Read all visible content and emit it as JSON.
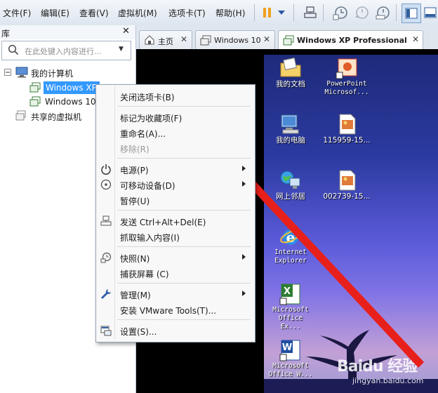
{
  "menubar": {
    "items": [
      "文件(F)",
      "编辑(E)",
      "查看(V)",
      "虚拟机(M)",
      "选项卡(T)",
      "帮助(H)"
    ]
  },
  "library": {
    "title": "库",
    "search_placeholder": "在此处键入内容进行...",
    "tree": {
      "root": "我的计算机",
      "vm1": "Windows XP Prof",
      "vm2": "Windows 10",
      "shared": "共享的虚拟机"
    }
  },
  "tabs": [
    {
      "label": "主页",
      "active": false
    },
    {
      "label": "Windows 10",
      "active": false
    },
    {
      "label": "Windows XP Professional",
      "active": true
    }
  ],
  "desktop": {
    "icons": [
      {
        "label": "我的文档",
        "icon": "folder-documents-icon"
      },
      {
        "label": "PowerPoint Microsof...",
        "icon": "powerpoint-shortcut-icon"
      },
      {
        "label": "我的电脑",
        "icon": "my-computer-icon"
      },
      {
        "label": "115959-15...",
        "icon": "image-file-icon"
      },
      {
        "label": "网上邻居",
        "icon": "network-places-icon"
      },
      {
        "label": "002739-15...",
        "icon": "image-file-icon"
      },
      {
        "label": "Internet Explorer",
        "icon": "internet-explorer-icon"
      },
      {
        "label": "Microsoft Office Ex...",
        "icon": "excel-shortcut-icon"
      },
      {
        "label": "Microsoft Office W...",
        "icon": "word-shortcut-icon"
      }
    ]
  },
  "context_menu": {
    "items": [
      {
        "label": "关闭选项卡(B)",
        "enabled": true
      },
      {
        "label": "标记为收藏项(F)",
        "enabled": true
      },
      {
        "label": "重命名(A)...",
        "enabled": true
      },
      {
        "label": "移除(R)",
        "enabled": false
      },
      {
        "label": "电源(P)",
        "enabled": true,
        "submenu": true,
        "icon": "power-icon"
      },
      {
        "label": "可移动设备(D)",
        "enabled": true,
        "submenu": true,
        "icon": "removable-device-icon"
      },
      {
        "label": "暂停(U)",
        "enabled": true
      },
      {
        "label": "发送 Ctrl+Alt+Del(E)",
        "enabled": true,
        "icon": "send-keys-icon"
      },
      {
        "label": "抓取输入内容(I)",
        "enabled": true
      },
      {
        "label": "快照(N)",
        "enabled": true,
        "submenu": true,
        "icon": "snapshot-icon"
      },
      {
        "label": "捕获屏幕 (C)",
        "enabled": true
      },
      {
        "label": "管理(M)",
        "enabled": true,
        "submenu": true,
        "icon": "wrench-icon"
      },
      {
        "label": "安装 VMware Tools(T)...",
        "enabled": true
      },
      {
        "label": "设置(S)...",
        "enabled": true,
        "icon": "settings-icon"
      }
    ]
  },
  "watermark": {
    "brand": "Baidu 经验",
    "sub": "jingyan.baidu.com"
  },
  "colors": {
    "selection": "#3399ff",
    "annotation_arrow": "#e8201c",
    "pause_icon": "#f0a020"
  }
}
